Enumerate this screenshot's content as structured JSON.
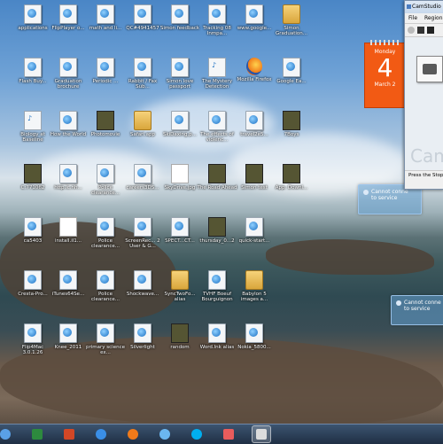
{
  "desktop": {
    "icons": [
      {
        "label": "applications",
        "kind": "doc"
      },
      {
        "label": "FlipPlayer o...",
        "kind": "doc"
      },
      {
        "label": "math and li...",
        "kind": "doc"
      },
      {
        "label": "QC#4941457",
        "kind": "doc"
      },
      {
        "label": "Simon feedback",
        "kind": "doc"
      },
      {
        "label": "Tracking 08 Inmpa...",
        "kind": "doc"
      },
      {
        "label": "www.google...",
        "kind": "doc"
      },
      {
        "label": "Simon Graduation...",
        "kind": "folder"
      },
      {
        "label": "Flash Buy...",
        "kind": "doc"
      },
      {
        "label": "Graduation brochure",
        "kind": "doc"
      },
      {
        "label": "Periodic ...",
        "kind": "doc"
      },
      {
        "label": "Rabbit / Fax Sub...",
        "kind": "doc"
      },
      {
        "label": "Simon love passport",
        "kind": "doc"
      },
      {
        "label": "The Mystery Detection",
        "kind": "mp3"
      },
      {
        "label": "Mozilla Firefox",
        "kind": "firefox"
      },
      {
        "label": "Google Ea...",
        "kind": "doc"
      },
      {
        "label": "Biology at Baseline",
        "kind": "mp3"
      },
      {
        "label": "How the World",
        "kind": "doc"
      },
      {
        "label": "Photomovie",
        "kind": "thumb"
      },
      {
        "label": "Safari.app",
        "kind": "folder"
      },
      {
        "label": "SkiDaxing.p...",
        "kind": "doc"
      },
      {
        "label": "The effects of violenc...",
        "kind": "doc"
      },
      {
        "label": "travel2e5...",
        "kind": "doc"
      },
      {
        "label": "7Boys",
        "kind": "thumb"
      },
      {
        "label": "C:771062",
        "kind": "thumb"
      },
      {
        "label": "http.ic.nh...",
        "kind": "doc"
      },
      {
        "label": "Police clearance...",
        "kind": "doc"
      },
      {
        "label": "careers3DS...",
        "kind": "doc"
      },
      {
        "label": "SkyDrive.jpg",
        "kind": "blank"
      },
      {
        "label": "The Road Ahead",
        "kind": "thumb"
      },
      {
        "label": "Simon test",
        "kind": "thumb"
      },
      {
        "label": "App. Downl...",
        "kind": "thumb"
      },
      {
        "label": "ca5403",
        "kind": "doc"
      },
      {
        "label": "install.il1...",
        "kind": "blank"
      },
      {
        "label": "Police clearance...",
        "kind": "doc"
      },
      {
        "label": "ScreenRec... 2 User & G...",
        "kind": "doc"
      },
      {
        "label": "SPECT...CT...",
        "kind": "doc"
      },
      {
        "label": "thursday_0...2",
        "kind": "thumb"
      },
      {
        "label": "quick-start...",
        "kind": "doc"
      },
      {
        "label": "Cresta-Pro...",
        "kind": "doc"
      },
      {
        "label": "iTunes64Se...",
        "kind": "doc"
      },
      {
        "label": "Police clearance...",
        "kind": "doc"
      },
      {
        "label": "Shockwave...",
        "kind": "doc"
      },
      {
        "label": "SyncTwoFo... alias",
        "kind": "folder"
      },
      {
        "label": "TVHF Boeuf Bourguignon",
        "kind": "doc"
      },
      {
        "label": "Babylon 5 images a...",
        "kind": "folder"
      },
      {
        "label": "Flip4Mac 3.0.1.26",
        "kind": "doc"
      },
      {
        "label": "Knee_2011",
        "kind": "doc"
      },
      {
        "label": "primary science ex...",
        "kind": "doc"
      },
      {
        "label": "Silverlight",
        "kind": "doc"
      },
      {
        "label": "random",
        "kind": "thumb"
      },
      {
        "label": "Word.lnk alias",
        "kind": "doc"
      },
      {
        "label": "Nokia_5800...",
        "kind": "doc"
      }
    ]
  },
  "calendar": {
    "day": "Monday",
    "date": "4",
    "month": "March 2"
  },
  "camstudio": {
    "title": "CamStudio",
    "menu": [
      "File",
      "Region"
    ],
    "brand": "Cam",
    "status": "Press the Stop"
  },
  "notifications": [
    {
      "text_line1": "Cannot conne",
      "text_line2": "to service"
    },
    {
      "text_line1": "Cannot conne",
      "text_line2": "to service"
    }
  ],
  "taskbar": {
    "items": [
      {
        "name": "start-icon",
        "color": "#5aa0e6"
      },
      {
        "name": "excel-icon",
        "color": "#2d8a3e"
      },
      {
        "name": "powerpoint-icon",
        "color": "#d24726"
      },
      {
        "name": "ie-icon",
        "color": "#3a8ee6"
      },
      {
        "name": "firefox-icon",
        "color": "#f07a1a"
      },
      {
        "name": "itunes-icon",
        "color": "#6bb7f0"
      },
      {
        "name": "skype-icon",
        "color": "#00aff0"
      },
      {
        "name": "media-icon",
        "color": "#e85c5c"
      },
      {
        "name": "camstudio-icon",
        "color": "#dcdcdc"
      }
    ]
  }
}
